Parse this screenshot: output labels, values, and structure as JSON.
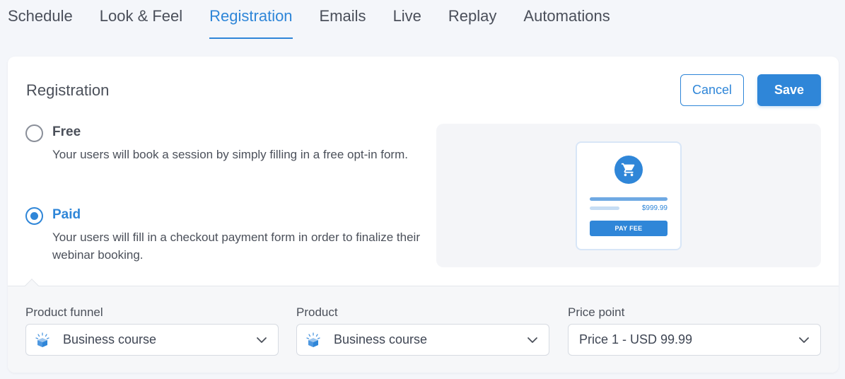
{
  "tabs": [
    {
      "label": "Schedule"
    },
    {
      "label": "Look & Feel"
    },
    {
      "label": "Registration"
    },
    {
      "label": "Emails"
    },
    {
      "label": "Live"
    },
    {
      "label": "Replay"
    },
    {
      "label": "Automations"
    }
  ],
  "active_tab": "Registration",
  "card": {
    "title": "Registration",
    "cancel_label": "Cancel",
    "save_label": "Save"
  },
  "options": {
    "free": {
      "label": "Free",
      "description": "Your users will book a session by simply filling in a free opt-in form.",
      "checked": false
    },
    "paid": {
      "label": "Paid",
      "description": "Your users will fill in a checkout payment form in order to finalize their webinar booking.",
      "checked": true
    }
  },
  "preview": {
    "icon": "shopping-cart-icon",
    "price": "$999.99",
    "pay_button": "PAY FEE"
  },
  "fields": {
    "product_funnel": {
      "label": "Product funnel",
      "value": "Business course",
      "icon": "product-box-icon"
    },
    "product": {
      "label": "Product",
      "value": "Business course",
      "icon": "product-box-icon"
    },
    "price_point": {
      "label": "Price point",
      "value": "Price 1 - USD 99.99"
    }
  },
  "colors": {
    "accent": "#2f86d8",
    "text": "#4b505a",
    "background": "#f4f6fa"
  }
}
